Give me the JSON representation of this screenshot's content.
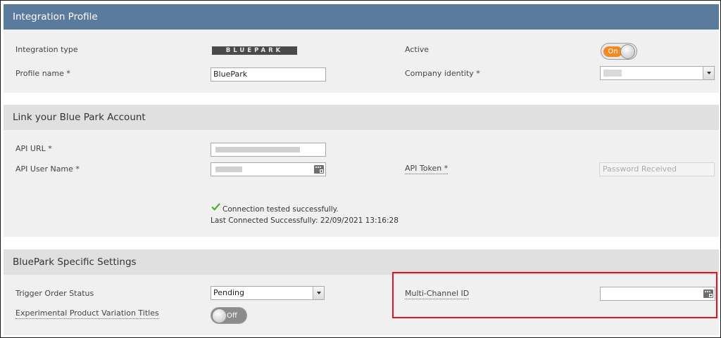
{
  "integration_profile": {
    "header": "Integration Profile",
    "integration_type_label": "Integration type",
    "integration_type_logo": "BLUEPARK",
    "active_label": "Active",
    "active_toggle": "On",
    "profile_name_label": "Profile name *",
    "profile_name_value": "BluePark",
    "company_identity_label": "Company identity *",
    "company_identity_value": ""
  },
  "link_account": {
    "header": "Link your Blue Park Account",
    "api_url_label": "API URL *",
    "api_url_value": "",
    "api_user_label": "API User Name *",
    "api_user_value": "",
    "api_token_label": "API Token *",
    "api_token_placeholder": "Password Received",
    "connection_status": "Connection tested successfully.",
    "last_connected": "Last Connected Successfully: 22/09/2021 13:16:28"
  },
  "specific_settings": {
    "header": "BluePark Specific Settings",
    "trigger_status_label": "Trigger Order Status",
    "trigger_status_value": "Pending",
    "variation_titles_label": "Experimental Product Variation Titles",
    "variation_toggle": "Off",
    "multi_channel_label": "Multi-Channel ID",
    "multi_channel_value": ""
  },
  "colors": {
    "header_blue": "#5b7b9d",
    "toggle_on": "#f28a24",
    "highlight_red": "#e0141e",
    "success_green": "#4caf2a"
  }
}
